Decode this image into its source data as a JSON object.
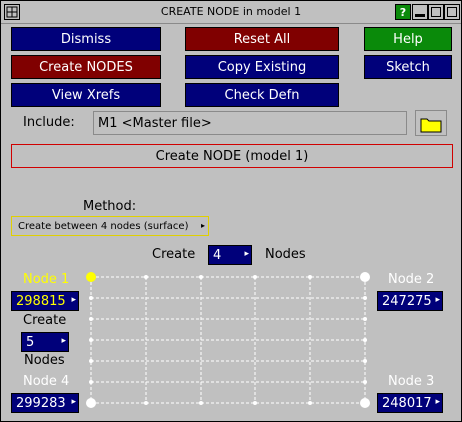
{
  "window": {
    "title": "CREATE NODE in model 1",
    "help_mark": "?"
  },
  "buttons": {
    "dismiss": "Dismiss",
    "reset_all": "Reset All",
    "help": "Help",
    "create_nodes": "Create NODES",
    "copy_existing": "Copy Existing",
    "sketch": "Sketch",
    "view_xrefs": "View Xrefs",
    "check_defn": "Check Defn"
  },
  "include": {
    "label": "Include:",
    "value": "M1  <Master file>"
  },
  "header": {
    "title": "Create NODE (model 1)"
  },
  "method": {
    "label": "Method:",
    "value": "Create between 4 nodes (surface)"
  },
  "create_row": {
    "prefix": "Create",
    "count": "4",
    "suffix": "Nodes"
  },
  "corners": {
    "node1_label": "Node 1",
    "node1_value": "298815",
    "node2_label": "Node 2",
    "node2_value": "247275",
    "node3_label": "Node 3",
    "node3_value": "248017",
    "node4_label": "Node 4",
    "node4_value": "299283"
  },
  "side_create": {
    "prefix": "Create",
    "count": "5",
    "suffix": "Nodes"
  },
  "colors": {
    "button_blue": "#00007a",
    "button_red": "#800000",
    "button_green": "#0a8a0a",
    "header_border": "#d00000",
    "active_node": "#ffff00"
  }
}
